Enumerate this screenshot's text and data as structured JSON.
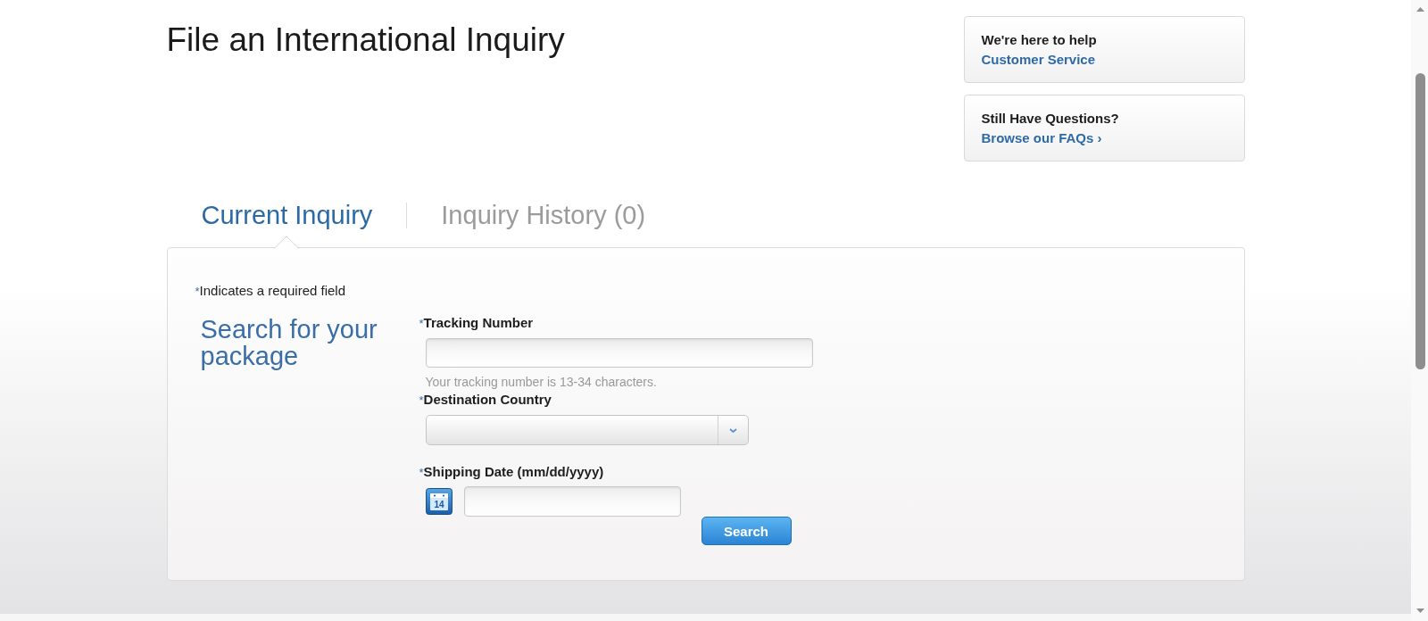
{
  "page_title": "File an International Inquiry",
  "help_cards": [
    {
      "heading": "We're here to help",
      "link": "Customer Service"
    },
    {
      "heading": "Still Have Questions?",
      "link": "Browse our FAQs ›"
    }
  ],
  "tabs": [
    {
      "label": "Current Inquiry",
      "selected": true
    },
    {
      "label": "Inquiry History (0)",
      "selected": false
    }
  ],
  "form": {
    "required_note": {
      "marker": "*",
      "text": "Indicates a required field"
    },
    "heading": "Search for your package",
    "fields": [
      {
        "kind": "text",
        "marker": "*",
        "label": "Tracking Number",
        "hint": "Your tracking number is 13-34 characters."
      },
      {
        "kind": "select",
        "marker": "*",
        "label": "Destination Country"
      },
      {
        "kind": "date",
        "marker": "*",
        "label": "Shipping Date (mm/dd/yyyy)",
        "calendar_day": "14"
      }
    ],
    "submit": "Search"
  }
}
